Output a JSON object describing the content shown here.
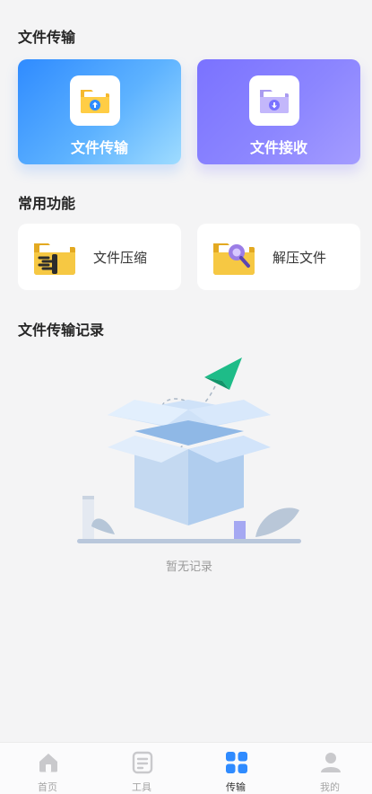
{
  "section_transfer": {
    "title": "文件传输"
  },
  "transfer_cards": [
    {
      "label": "文件传输",
      "icon": "folder-upload-icon",
      "color": "#3d93ff"
    },
    {
      "label": "文件接收",
      "icon": "folder-download-icon",
      "color": "#7f78ff"
    }
  ],
  "section_common": {
    "title": "常用功能"
  },
  "functions": [
    {
      "label": "文件压缩",
      "icon": "zip-folder-icon"
    },
    {
      "label": "解压文件",
      "icon": "unzip-folder-icon"
    }
  ],
  "section_records": {
    "title": "文件传输记录"
  },
  "empty_state": {
    "text": "暂无记录",
    "illustration": "empty-box-paper-plane-icon"
  },
  "tabbar": {
    "tabs": [
      {
        "label": "首页",
        "icon": "home-icon",
        "active": false
      },
      {
        "label": "工具",
        "icon": "tools-document-icon",
        "active": false
      },
      {
        "label": "传输",
        "icon": "grid-icon",
        "active": true
      },
      {
        "label": "我的",
        "icon": "user-icon",
        "active": false
      }
    ]
  },
  "colors": {
    "accent": "#2f8bff",
    "purple": "#7a72ff",
    "background": "#f4f4f5"
  }
}
